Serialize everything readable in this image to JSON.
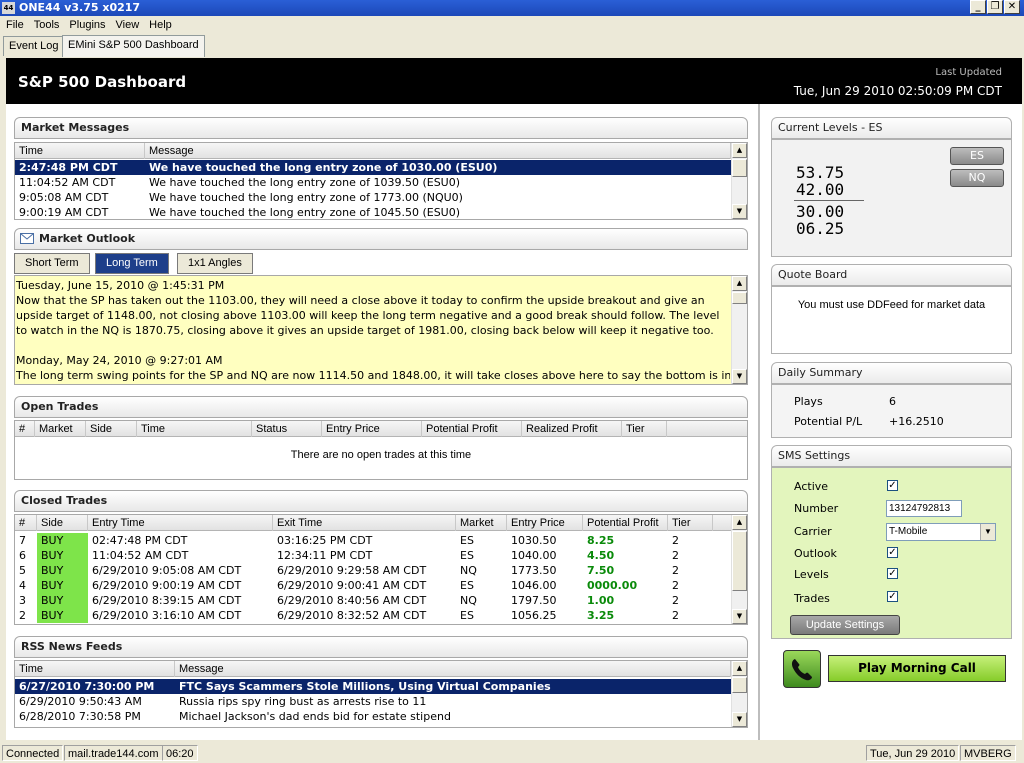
{
  "window": {
    "title": "ONE44 v3.75  x0217",
    "icon_text": "44",
    "minimize": "_",
    "restore": "❐",
    "close": "✕"
  },
  "menu": [
    "File",
    "Tools",
    "Plugins",
    "View",
    "Help"
  ],
  "top_tabs": [
    {
      "label": "Event Log"
    },
    {
      "label": "EMini S&P 500 Dashboard"
    }
  ],
  "header": {
    "title": "S&P 500 Dashboard",
    "last_updated_label": "Last Updated",
    "last_updated_value": "Tue, Jun 29 2010 02:50:09 PM CDT"
  },
  "market_messages": {
    "title": "Market Messages",
    "columns": [
      "Time",
      "Message"
    ],
    "rows": [
      {
        "time": "2:47:48 PM CDT",
        "message": "We have touched the long entry zone of 1030.00 (ESU0)"
      },
      {
        "time": "11:04:52 AM CDT",
        "message": "We have touched the long entry zone of 1039.50 (ESU0)"
      },
      {
        "time": "9:05:08 AM CDT",
        "message": "We have touched the long entry zone of 1773.00 (NQU0)"
      },
      {
        "time": "9:00:19 AM CDT",
        "message": "We have touched the long entry zone of 1045.50 (ESU0)"
      }
    ]
  },
  "market_outlook": {
    "title": "Market Outlook",
    "tabs": [
      "Short Term",
      "Long Term",
      "1x1 Angles"
    ],
    "entries": [
      {
        "date": "Tuesday, June 15, 2010 @ 1:45:31 PM",
        "text": "Now that the SP has taken out the 1103.00, they will need a close above it today to confirm the upside breakout and give an upside target of 1148.00, not closing above 1103.00 will keep the long term negative and a good break should follow. The level to watch in the NQ is 1870.75, closing above it gives an upside target of 1981.00, closing back below will keep it negative too."
      },
      {
        "date": "Monday, May 24, 2010 @ 9:27:01 AM",
        "text": "The long term swing points for the SP and NQ are now 1114.50 and 1848.00, it will take closes above here to say the bottom is in for"
      }
    ]
  },
  "open_trades": {
    "title": "Open Trades",
    "columns": [
      "#",
      "Market",
      "Side",
      "Time",
      "Status",
      "Entry Price",
      "Potential Profit",
      "Realized Profit",
      "Tier"
    ],
    "empty_text": "There are no open trades at this time"
  },
  "closed_trades": {
    "title": "Closed Trades",
    "columns": [
      "#",
      "Side",
      "Entry Time",
      "Exit Time",
      "Market",
      "Entry Price",
      "Potential Profit",
      "Tier"
    ],
    "rows": [
      {
        "num": "7",
        "side": "BUY",
        "entry": "02:47:48 PM CDT",
        "exit": "03:16:25 PM CDT",
        "market": "ES",
        "price": "1030.50",
        "profit": "8.25",
        "tier": "2"
      },
      {
        "num": "6",
        "side": "BUY",
        "entry": "11:04:52 AM CDT",
        "exit": "12:34:11 PM CDT",
        "market": "ES",
        "price": "1040.00",
        "profit": "4.50",
        "tier": "2"
      },
      {
        "num": "5",
        "side": "BUY",
        "entry": "6/29/2010 9:05:08 AM CDT",
        "exit": "6/29/2010 9:29:58 AM CDT",
        "market": "NQ",
        "price": "1773.50",
        "profit": "7.50",
        "tier": "2"
      },
      {
        "num": "4",
        "side": "BUY",
        "entry": "6/29/2010 9:00:19 AM CDT",
        "exit": "6/29/2010 9:00:41 AM CDT",
        "market": "ES",
        "price": "1046.00",
        "profit": "0000.00",
        "tier": "2"
      },
      {
        "num": "3",
        "side": "BUY",
        "entry": "6/29/2010 8:39:15 AM CDT",
        "exit": "6/29/2010 8:40:56 AM CDT",
        "market": "NQ",
        "price": "1797.50",
        "profit": "1.00",
        "tier": "2"
      },
      {
        "num": "2",
        "side": "BUY",
        "entry": "6/29/2010 3:16:10 AM CDT",
        "exit": "6/29/2010 8:32:52 AM CDT",
        "market": "ES",
        "price": "1056.25",
        "profit": "3.25",
        "tier": "2"
      }
    ]
  },
  "rss": {
    "title": "RSS News Feeds",
    "columns": [
      "Time",
      "Message"
    ],
    "rows": [
      {
        "time": "6/27/2010 7:30:00 PM",
        "message": "FTC Says Scammers Stole Millions, Using Virtual Companies"
      },
      {
        "time": "6/29/2010 9:50:43 AM",
        "message": "Russia rips spy ring bust as arrests rise to 11"
      },
      {
        "time": "6/28/2010 7:30:58 PM",
        "message": "Michael Jackson's dad ends bid for estate stipend"
      }
    ]
  },
  "current_levels": {
    "title": "Current Levels - ES",
    "upper": [
      "53.75",
      "42.00"
    ],
    "lower": [
      "30.00",
      "06.25"
    ],
    "buttons": [
      "ES",
      "NQ"
    ]
  },
  "quote_board": {
    "title": "Quote Board",
    "message": "You must use DDFeed for market data"
  },
  "daily_summary": {
    "title": "Daily Summary",
    "plays_label": "Plays",
    "plays_value": "6",
    "pl_label": "Potential P/L",
    "pl_value": "+16.2510"
  },
  "sms": {
    "title": "SMS Settings",
    "active_label": "Active",
    "number_label": "Number",
    "number_value": "13124792813",
    "carrier_label": "Carrier",
    "carrier_value": "T-Mobile",
    "outlook_label": "Outlook",
    "levels_label": "Levels",
    "trades_label": "Trades",
    "update_button": "Update Settings"
  },
  "play_morning_call": "Play Morning Call",
  "status": {
    "connection": "Connected",
    "server": "mail.trade144.com",
    "time": "06:20",
    "date": "Tue, Jun 29 2010",
    "user": "MVBERG"
  },
  "colors": {
    "accent": "#0a246a",
    "buy": "#7ee44a",
    "sms_bg": "#e3f5bd",
    "profit": "#0a8a0a"
  }
}
